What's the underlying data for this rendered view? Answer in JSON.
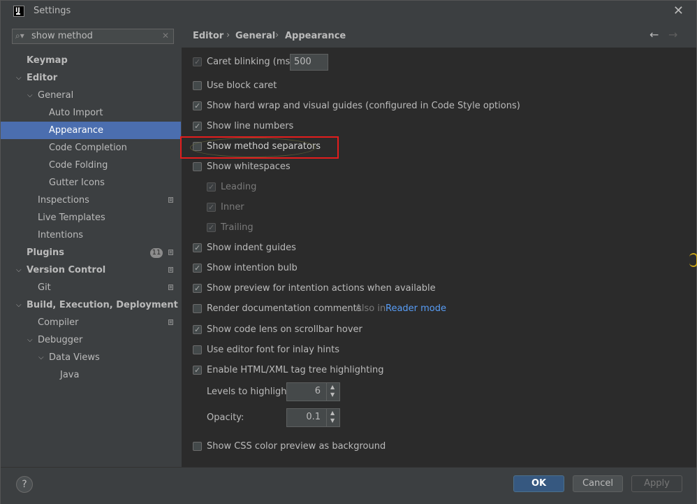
{
  "window": {
    "title": "Settings",
    "app_icon_text": "IJ"
  },
  "search": {
    "value": "show method"
  },
  "sidebar": {
    "items": [
      {
        "label": "Keymap"
      },
      {
        "label": "Editor"
      },
      {
        "label": "General"
      },
      {
        "label": "Auto Import"
      },
      {
        "label": "Appearance"
      },
      {
        "label": "Code Completion"
      },
      {
        "label": "Code Folding"
      },
      {
        "label": "Gutter Icons"
      },
      {
        "label": "Inspections"
      },
      {
        "label": "Live Templates"
      },
      {
        "label": "Intentions"
      },
      {
        "label": "Plugins",
        "badge": "11"
      },
      {
        "label": "Version Control"
      },
      {
        "label": "Git"
      },
      {
        "label": "Build, Execution, Deployment"
      },
      {
        "label": "Compiler"
      },
      {
        "label": "Debugger"
      },
      {
        "label": "Data Views"
      },
      {
        "label": "Java"
      }
    ]
  },
  "breadcrumb": {
    "items": [
      "Editor",
      "General",
      "Appearance"
    ]
  },
  "options": {
    "caret_blinking": {
      "label": "Caret blinking (ms):",
      "value": "500",
      "checked": true
    },
    "block_caret": {
      "label": "Use block caret",
      "checked": false
    },
    "hard_wrap": {
      "label": "Show hard wrap and visual guides (configured in Code Style options)",
      "checked": true
    },
    "line_numbers": {
      "label": "Show line numbers",
      "checked": true
    },
    "method_separators": {
      "label": "Show method separators",
      "checked": false
    },
    "whitespaces": {
      "label": "Show whitespaces",
      "checked": false
    },
    "leading": {
      "label": "Leading",
      "checked": true
    },
    "inner": {
      "label": "Inner",
      "checked": true
    },
    "trailing": {
      "label": "Trailing",
      "checked": true
    },
    "indent_guides": {
      "label": "Show indent guides",
      "checked": true
    },
    "intention_bulb": {
      "label": "Show intention bulb",
      "checked": true
    },
    "preview_intention": {
      "label": "Show preview for intention actions when available",
      "checked": true
    },
    "render_docs": {
      "label": "Render documentation comments",
      "aux": "Also in",
      "link": "Reader mode",
      "checked": false
    },
    "code_lens": {
      "label": "Show code lens on scrollbar hover",
      "checked": true
    },
    "editor_font_inlay": {
      "label": "Use editor font for inlay hints",
      "checked": false
    },
    "tag_tree": {
      "label": "Enable HTML/XML tag tree highlighting",
      "checked": true
    },
    "levels": {
      "label": "Levels to highlight:",
      "value": "6"
    },
    "opacity": {
      "label": "Opacity:",
      "value": "0.1"
    },
    "css_color_preview": {
      "label": "Show CSS color preview as background",
      "checked": false
    }
  },
  "footer": {
    "help": "?",
    "ok": "OK",
    "cancel": "Cancel",
    "apply": "Apply"
  }
}
